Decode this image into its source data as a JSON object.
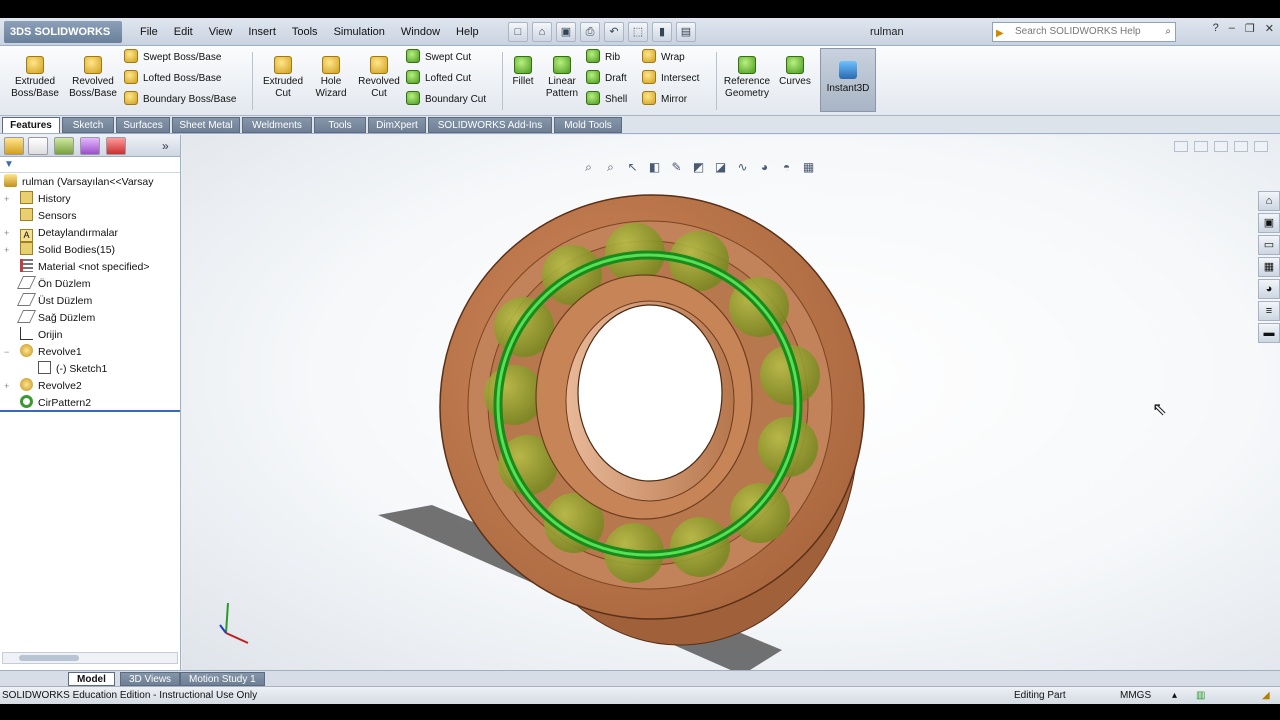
{
  "app": {
    "logo": "3DS SOLIDWORKS",
    "document_title": "rulman"
  },
  "menu": [
    "File",
    "Edit",
    "View",
    "Insert",
    "Tools",
    "Simulation",
    "Window",
    "Help"
  ],
  "search": {
    "placeholder": "Search SOLIDWORKS Help"
  },
  "commands": {
    "extruded_boss": "Extruded Boss/Base",
    "revolved_boss": "Revolved Boss/Base",
    "swept_boss": "Swept Boss/Base",
    "lofted_boss": "Lofted Boss/Base",
    "boundary_boss": "Boundary Boss/Base",
    "extruded_cut": "Extruded Cut",
    "hole_wizard": "Hole Wizard",
    "revolved_cut": "Revolved Cut",
    "swept_cut": "Swept Cut",
    "lofted_cut": "Lofted Cut",
    "boundary_cut": "Boundary Cut",
    "fillet": "Fillet",
    "linear_pattern": "Linear Pattern",
    "rib": "Rib",
    "draft": "Draft",
    "shell": "Shell",
    "wrap": "Wrap",
    "intersect": "Intersect",
    "mirror": "Mirror",
    "reference_geometry": "Reference Geometry",
    "curves": "Curves",
    "instant3d": "Instant3D"
  },
  "tabs": [
    "Features",
    "Sketch",
    "Surfaces",
    "Sheet Metal",
    "Weldments",
    "Tools",
    "DimXpert",
    "SOLIDWORKS Add-Ins",
    "Mold Tools"
  ],
  "tree": {
    "root": "rulman  (Varsayılan<<Varsay",
    "items": [
      "History",
      "Sensors",
      "Detaylandırmalar",
      "Solid Bodies(15)",
      "Material <not specified>",
      "Ön Düzlem",
      "Üst Düzlem",
      "Sağ Düzlem",
      "Orijin",
      "Revolve1",
      "(-) Sketch1",
      "Revolve2",
      "CirPattern2"
    ]
  },
  "bottom_tabs": [
    "Model",
    "3D Views",
    "Motion Study 1"
  ],
  "status": {
    "edition": "SOLIDWORKS Education Edition - Instructional Use Only",
    "mode": "Editing Part",
    "units": "MMGS"
  },
  "colors": {
    "bearing": "#b8764a",
    "ball_cage": "#2fbf2f",
    "balls": "#8a9a2a"
  }
}
